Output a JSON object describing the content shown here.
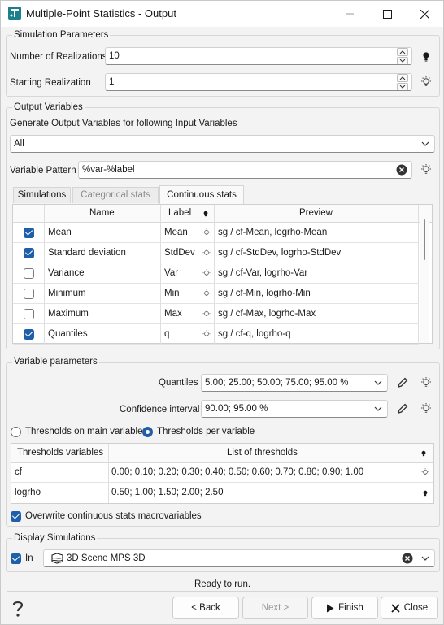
{
  "window": {
    "title": "Multiple-Point Statistics - Output"
  },
  "sim_params": {
    "title": "Simulation Parameters",
    "realizations_label": "Number of Realizations",
    "realizations_value": "10",
    "start_label": "Starting Realization",
    "start_value": "1"
  },
  "output_vars": {
    "title": "Output Variables",
    "generate_label": "Generate Output Variables for following Input Variables",
    "input_vars_value": "All",
    "pattern_label": "Variable Pattern",
    "pattern_value": "%var-%label",
    "tabs": [
      "Simulations",
      "Categorical stats",
      "Continuous stats"
    ],
    "table": {
      "headers": {
        "name": "Name",
        "label": "Label",
        "preview": "Preview"
      },
      "rows": [
        {
          "name": "Mean",
          "label": "Mean",
          "preview": "sg / cf-Mean, logrho-Mean"
        },
        {
          "name": "Standard deviation",
          "label": "StdDev",
          "preview": "sg / cf-StdDev, logrho-StdDev"
        },
        {
          "name": "Variance",
          "label": "Var",
          "preview": "sg / cf-Var, logrho-Var"
        },
        {
          "name": "Minimum",
          "label": "Min",
          "preview": "sg / cf-Min, logrho-Min"
        },
        {
          "name": "Maximum",
          "label": "Max",
          "preview": "sg / cf-Max, logrho-Max"
        },
        {
          "name": "Quantiles",
          "label": "q",
          "preview": "sg / cf-q, logrho-q"
        }
      ]
    }
  },
  "var_params": {
    "title": "Variable parameters",
    "quantiles_label": "Quantiles",
    "quantiles_value": "5.00; 25.00; 50.00; 75.00; 95.00 %",
    "confidence_label": "Confidence interval",
    "confidence_value": "90.00; 95.00 %",
    "radio_main": "Thresholds on main variable",
    "radio_per": "Thresholds per variable",
    "thresholds": {
      "headers": {
        "variables": "Thresholds variables",
        "list": "List of thresholds"
      },
      "rows": [
        {
          "var": "cf",
          "list": "0.00; 0.10; 0.20; 0.30; 0.40; 0.50; 0.60; 0.70; 0.80; 0.90; 1.00"
        },
        {
          "var": "logrho",
          "list": "0.50; 1.00; 1.50; 2.00; 2.50"
        }
      ]
    },
    "overwrite_label": "Overwrite continuous stats macrovariables"
  },
  "display": {
    "title": "Display Simulations",
    "in_label": "In",
    "scene_value": "3D Scene MPS 3D"
  },
  "status": "Ready to run.",
  "buttons": {
    "back": "< Back",
    "next": "Next >",
    "finish": "Finish",
    "close": "Close"
  },
  "colors": {
    "accent": "#1f5fa9",
    "background": "#f3f3f3"
  }
}
